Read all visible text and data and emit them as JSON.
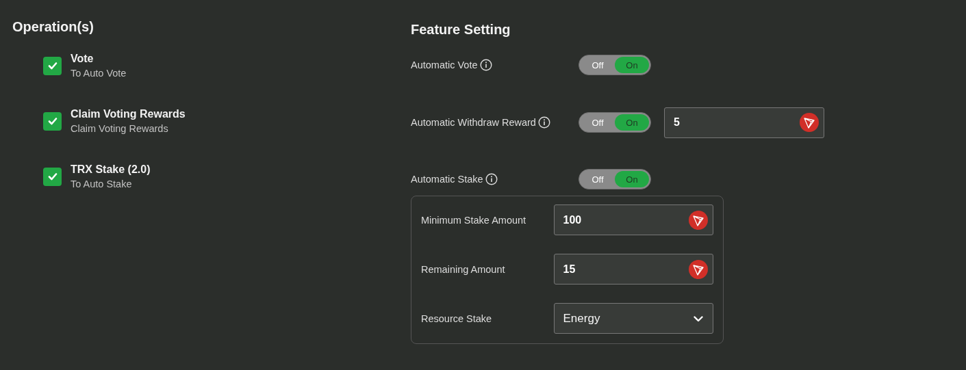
{
  "operations": {
    "title": "Operation(s)",
    "items": [
      {
        "title": "Vote",
        "description": "To Auto Vote",
        "checked": true
      },
      {
        "title": "Claim Voting Rewards",
        "description": "Claim Voting Rewards",
        "checked": true
      },
      {
        "title": "TRX Stake (2.0)",
        "description": "To Auto Stake",
        "checked": true
      }
    ]
  },
  "feature_setting": {
    "title": "Feature Setting",
    "rows": [
      {
        "label": "Automatic Vote",
        "toggle": {
          "off_label": "Off",
          "on_label": "On",
          "on": true
        }
      },
      {
        "label": "Automatic Withdraw Reward",
        "toggle": {
          "off_label": "Off",
          "on_label": "On",
          "on": true
        },
        "amount": {
          "value": "5"
        }
      },
      {
        "label": "Automatic Stake",
        "toggle": {
          "off_label": "Off",
          "on_label": "On",
          "on": true
        }
      }
    ],
    "stake_options": [
      {
        "kind": "amount",
        "label": "Minimum Stake Amount",
        "value": "100"
      },
      {
        "kind": "amount",
        "label": "Remaining Amount",
        "value": "15"
      },
      {
        "kind": "select",
        "label": "Resource Stake",
        "value": "Energy"
      }
    ]
  }
}
